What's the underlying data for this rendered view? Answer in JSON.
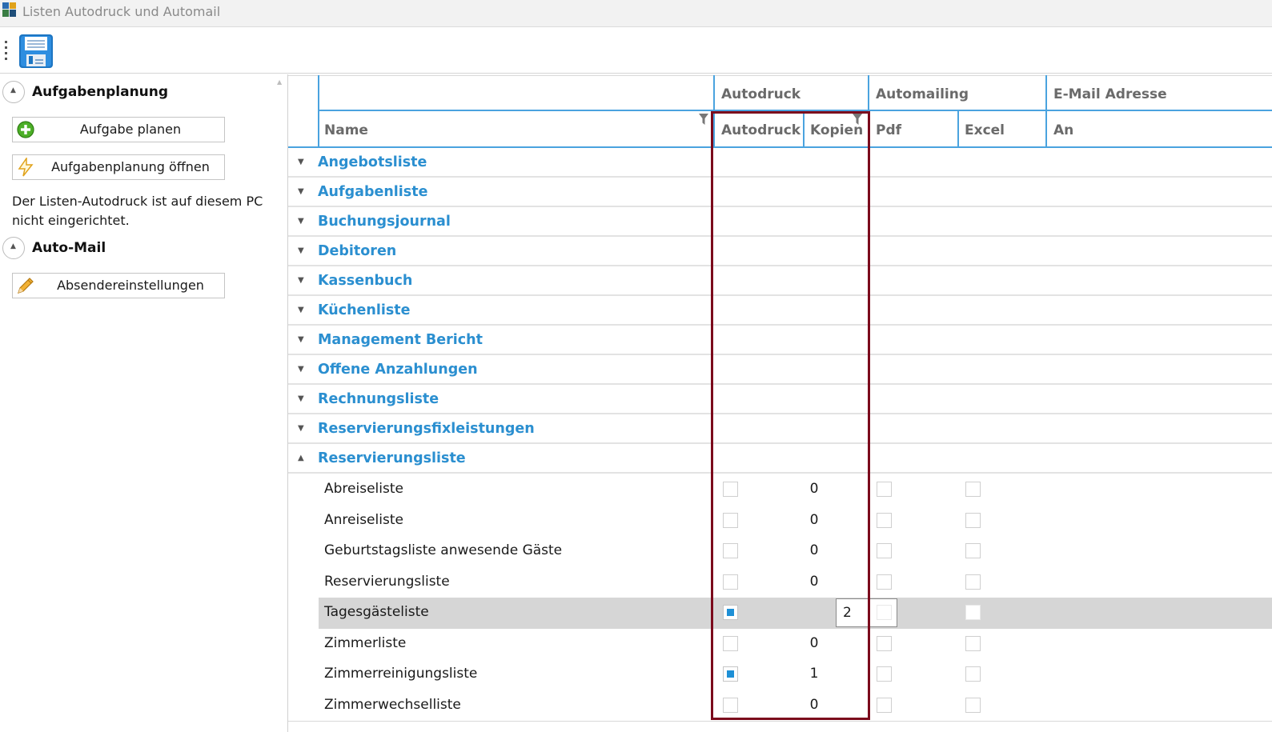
{
  "window": {
    "title": "Listen Autodruck und Automail"
  },
  "toolbar": {
    "save_icon": "save-icon"
  },
  "left_panel": {
    "sections": [
      {
        "title": "Aufgabenplanung",
        "buttons": [
          "Aufgabe planen",
          "Aufgabenplanung öffnen"
        ]
      },
      {
        "title": "Auto-Mail",
        "buttons": [
          "Absendereinstellungen"
        ]
      }
    ],
    "note": "Der Listen-Autodruck ist auf diesem PC nicht eingerichtet."
  },
  "grid": {
    "header_groups": [
      "Autodruck",
      "Automailing",
      "E-Mail Adresse"
    ],
    "columns": [
      "Name",
      "Autodruck",
      "Kopien",
      "Pdf",
      "Excel",
      "An"
    ],
    "groups": [
      "Angebotsliste",
      "Aufgabenliste",
      "Buchungsjournal",
      "Debitoren",
      "Kassenbuch",
      "Küchenliste",
      "Management Bericht",
      "Offene Anzahlungen",
      "Rechnungsliste",
      "Reservierungsfixleistungen",
      "Reservierungsliste"
    ],
    "expanded_group": "Reservierungsliste",
    "rows": [
      {
        "name": "Abreiseliste",
        "autodruck": false,
        "kopien": "0",
        "pdf": false,
        "excel": false
      },
      {
        "name": "Anreiseliste",
        "autodruck": false,
        "kopien": "0",
        "pdf": false,
        "excel": false
      },
      {
        "name": "Geburtstagsliste anwesende Gäste",
        "autodruck": false,
        "kopien": "0",
        "pdf": false,
        "excel": false
      },
      {
        "name": "Reservierungsliste",
        "autodruck": false,
        "kopien": "0",
        "pdf": false,
        "excel": false
      },
      {
        "name": "Tagesgästeliste",
        "autodruck": true,
        "kopien": "2",
        "pdf": false,
        "excel": false,
        "selected": true
      },
      {
        "name": "Zimmerliste",
        "autodruck": false,
        "kopien": "0",
        "pdf": false,
        "excel": false
      },
      {
        "name": "Zimmerreinigungsliste",
        "autodruck": true,
        "kopien": "1",
        "pdf": false,
        "excel": false
      },
      {
        "name": "Zimmerwechselliste",
        "autodruck": false,
        "kopien": "0",
        "pdf": false,
        "excel": false
      }
    ]
  },
  "colors": {
    "accent": "#2b8fd0",
    "header_line": "#4aa3df",
    "highlight": "#7b0a1c",
    "checkbox_fill": "#1e90d6",
    "selected_row": "#d6d6d6"
  }
}
